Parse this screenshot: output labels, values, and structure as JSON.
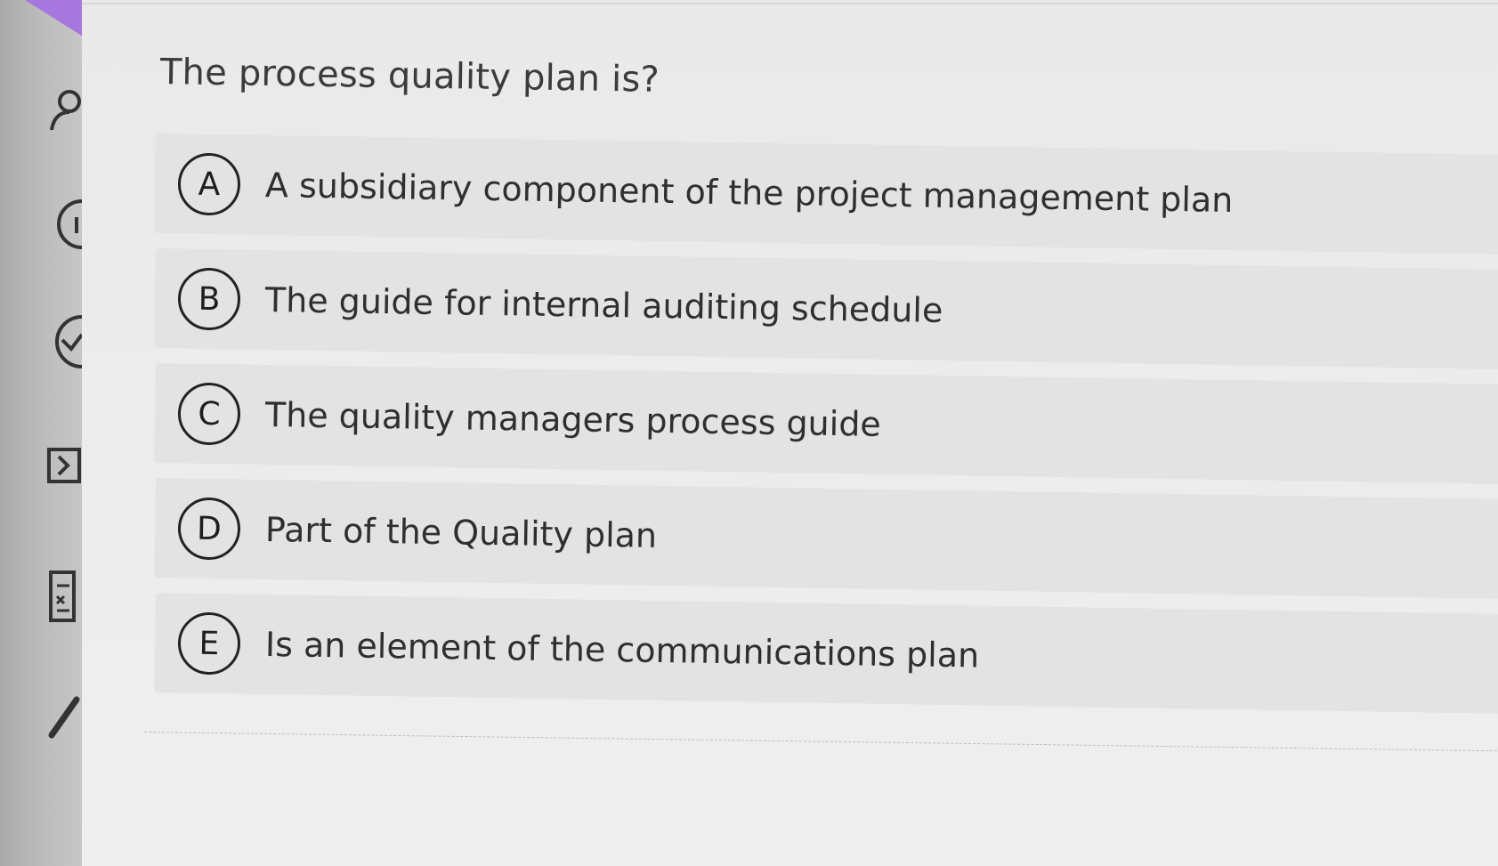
{
  "question": {
    "text": "The process quality plan is?"
  },
  "options": [
    {
      "letter": "A",
      "text": "A subsidiary component of the project management plan"
    },
    {
      "letter": "B",
      "text": "The guide for internal auditing schedule"
    },
    {
      "letter": "C",
      "text": "The quality managers process guide"
    },
    {
      "letter": "D",
      "text": "Part of the Quality plan"
    },
    {
      "letter": "E",
      "text": "Is an element of the communications plan"
    }
  ],
  "toolbar": {
    "icons": [
      "person-icon",
      "info-icon",
      "check-icon",
      "sigma-icon",
      "calculator-icon",
      "pen-icon"
    ]
  },
  "colors": {
    "accent": "#a678dd",
    "option_background": "#e3e3e3",
    "text": "#2f2f2f"
  }
}
